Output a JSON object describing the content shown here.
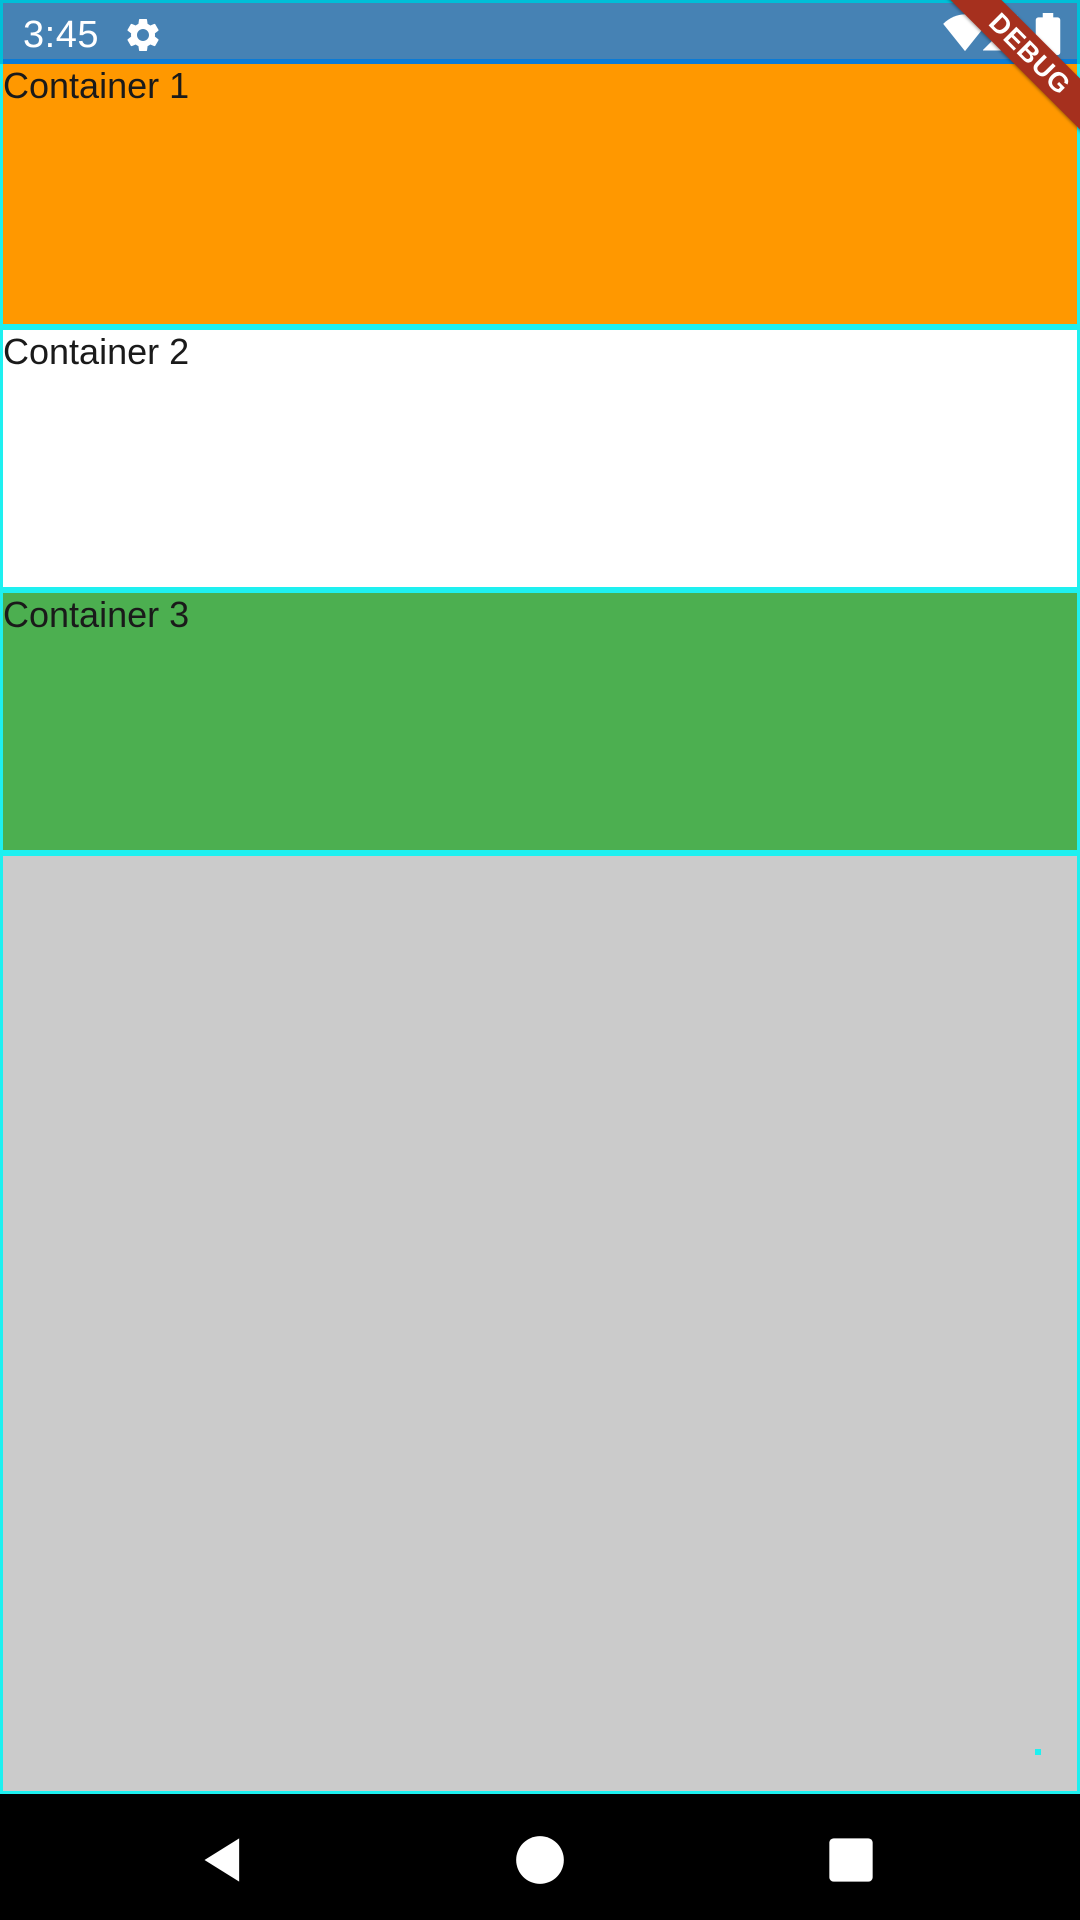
{
  "status_bar": {
    "time": "3:45",
    "icons": [
      "gear-icon",
      "wifi-icon",
      "signal-icon",
      "battery-icon"
    ],
    "background_color": "#4682B4"
  },
  "debug_banner": {
    "label": "DEBUG",
    "color": "#A6301E"
  },
  "containers": [
    {
      "label": "Container 1",
      "color": "#FF9800"
    },
    {
      "label": "Container 2",
      "color": "#FFFFFF"
    },
    {
      "label": "Container 3",
      "color": "#4CAF50"
    },
    {
      "label": "",
      "color": "#CBCBCB"
    }
  ],
  "border_color": "#1EF0F0",
  "nav_bar": {
    "icons": [
      "back-icon",
      "home-icon",
      "recents-icon"
    ]
  }
}
